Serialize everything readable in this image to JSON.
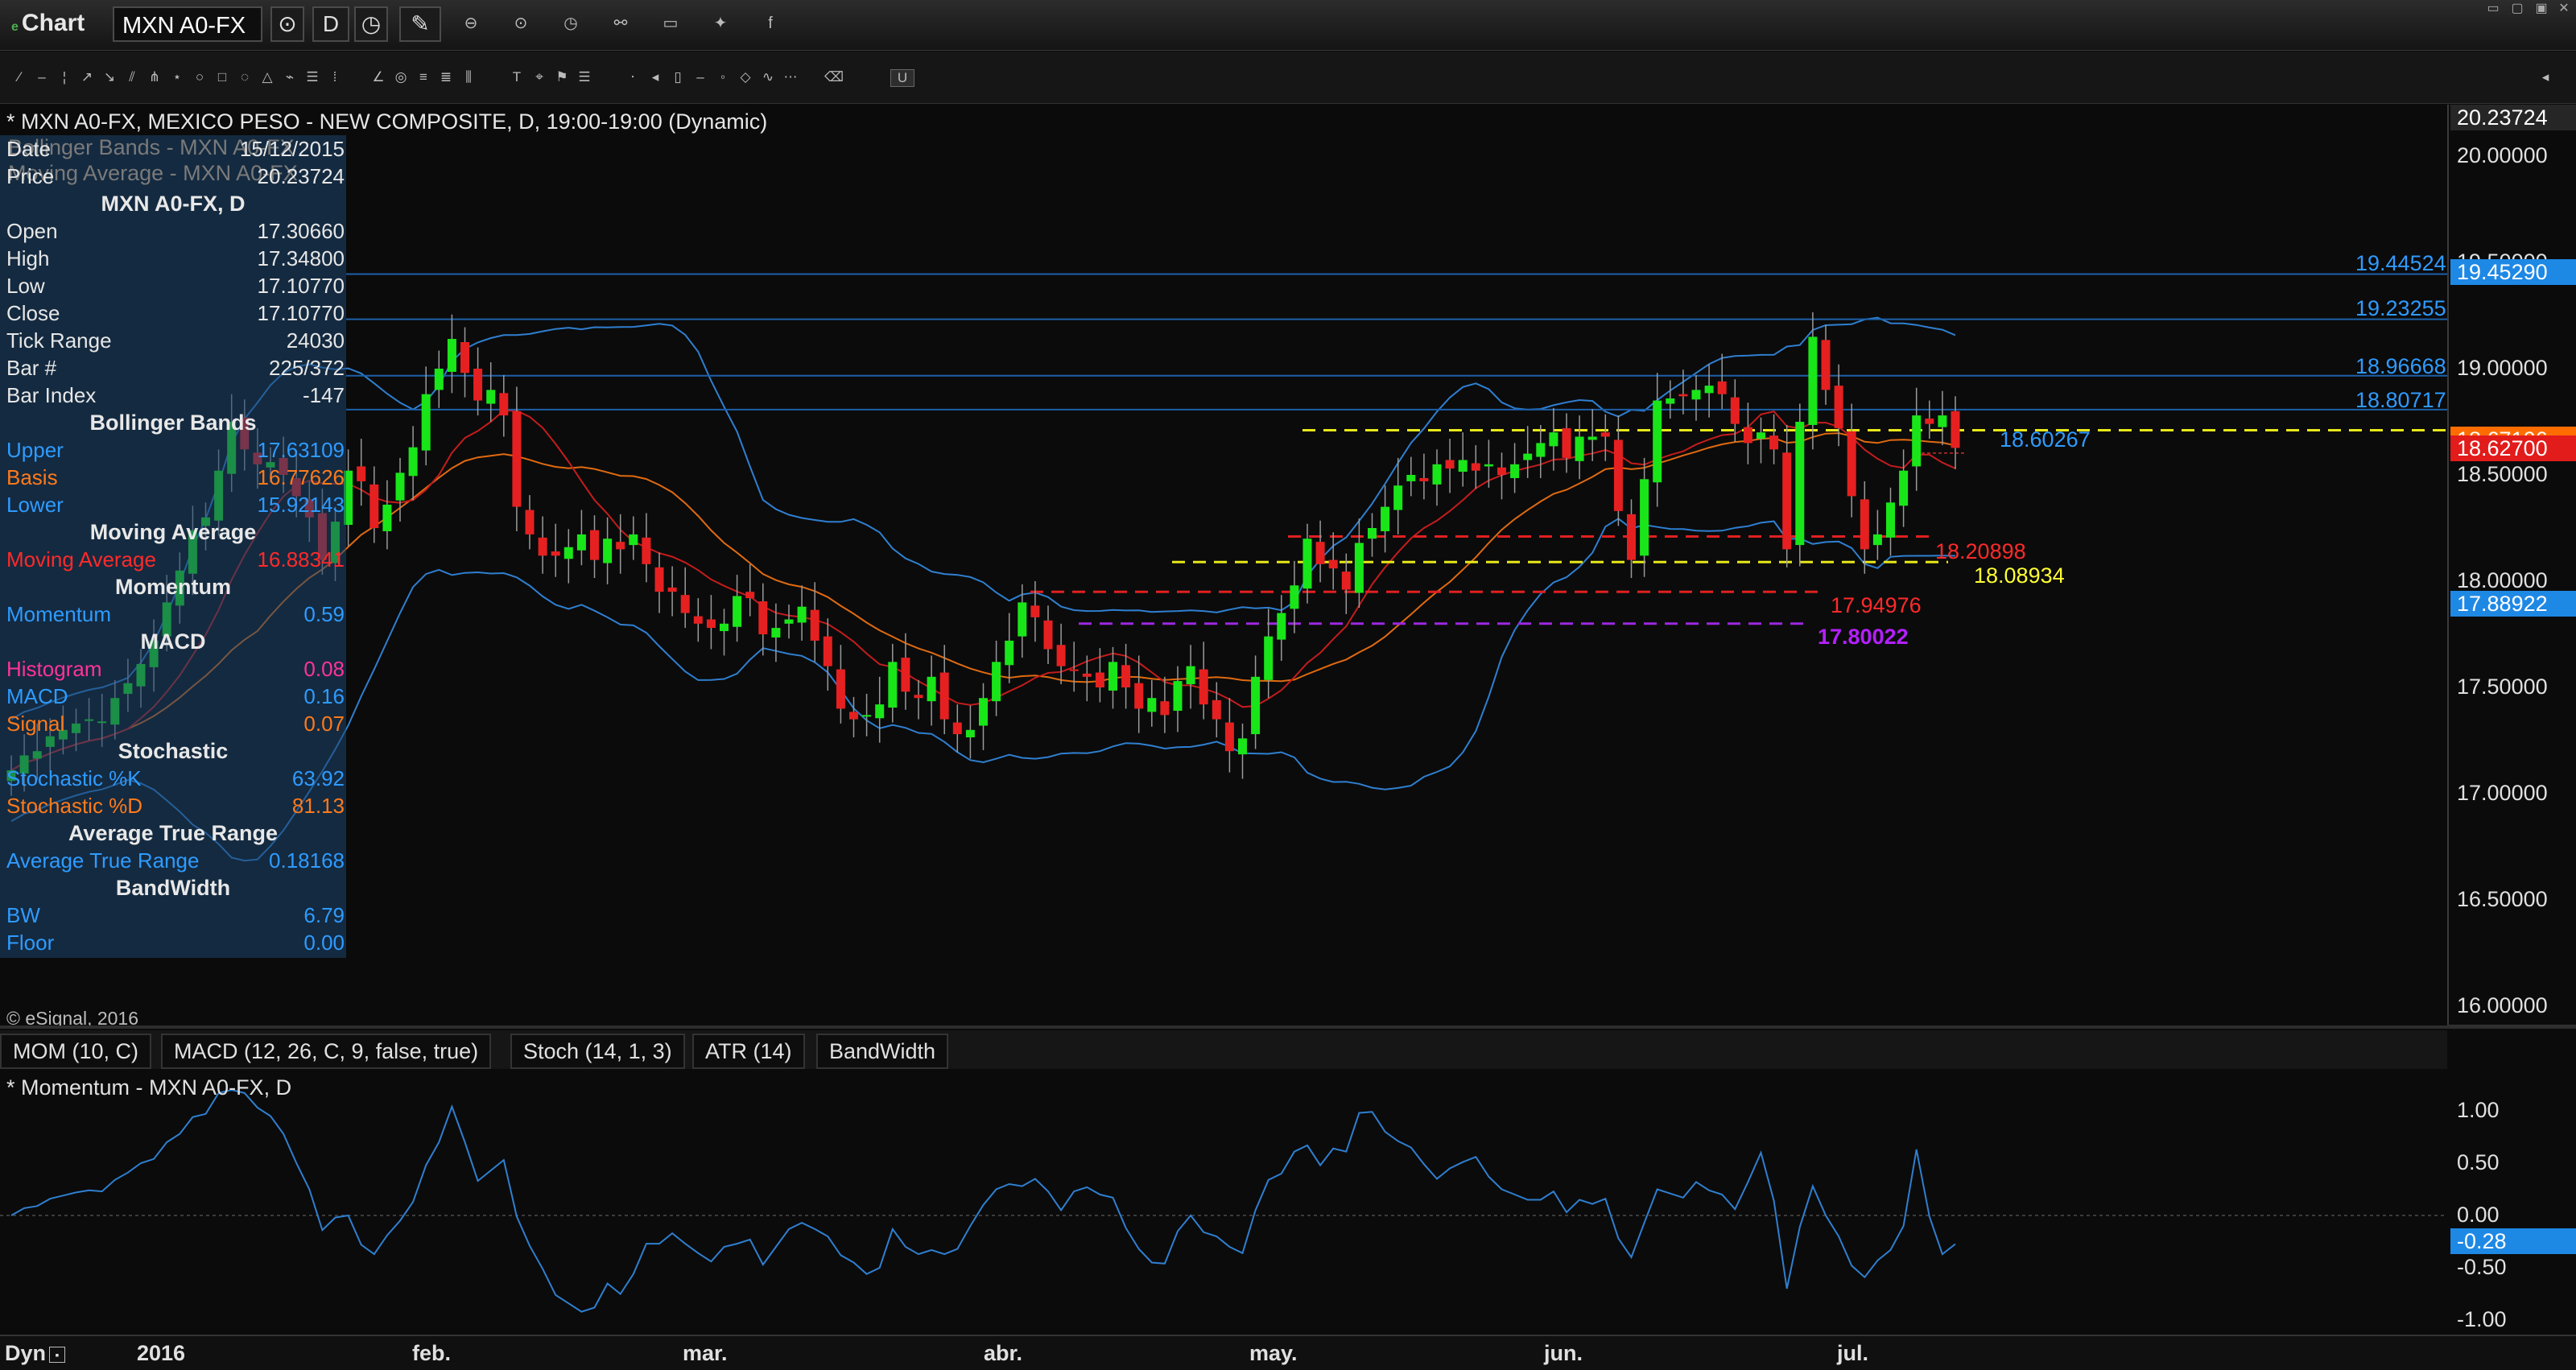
{
  "app": {
    "title": "Chart"
  },
  "toolbar": {
    "symbol": "MXN A0-FX",
    "interval": "D"
  },
  "chart": {
    "title": "* MXN A0-FX, MEXICO PESO - NEW COMPOSITE, D, 19:00-19:00 (Dynamic)",
    "ghost_lines": [
      "Bollinger Bands - MXN A0-FX",
      "Moving Average - MXN A0-FX"
    ],
    "copyright": "© eSignal, 2016"
  },
  "data_window": {
    "top_rows": [
      {
        "k": "Date",
        "v": "15/12/2015"
      },
      {
        "k": "Price",
        "v": "20.23724"
      }
    ],
    "symbol_header": "MXN A0-FX, D",
    "ohlc_rows": [
      {
        "k": "Open",
        "v": "17.30660"
      },
      {
        "k": "High",
        "v": "17.34800"
      },
      {
        "k": "Low",
        "v": "17.10770"
      },
      {
        "k": "Close",
        "v": "17.10770"
      },
      {
        "k": "Tick Range",
        "v": "24030"
      },
      {
        "k": "Bar #",
        "v": "225/372"
      },
      {
        "k": "Bar Index",
        "v": "-147"
      }
    ],
    "sections": [
      {
        "title": "Bollinger Bands",
        "rows": [
          {
            "k": "Upper",
            "v": "17.63109",
            "color": "#2f9bff"
          },
          {
            "k": "Basis",
            "v": "16.77626",
            "color": "#ff7a1a"
          },
          {
            "k": "Lower",
            "v": "15.92143",
            "color": "#2f9bff"
          }
        ]
      },
      {
        "title": "Moving Average",
        "rows": [
          {
            "k": "Moving Average",
            "v": "16.88341",
            "color": "#ff2a2a"
          }
        ]
      },
      {
        "title": "Momentum",
        "rows": [
          {
            "k": "Momentum",
            "v": "0.59",
            "color": "#2f9bff"
          }
        ]
      },
      {
        "title": "MACD",
        "rows": [
          {
            "k": "Histogram",
            "v": "0.08",
            "color": "#ff3399"
          },
          {
            "k": "MACD",
            "v": "0.16",
            "color": "#2f9bff"
          },
          {
            "k": "Signal",
            "v": "0.07",
            "color": "#ff7a1a"
          }
        ]
      },
      {
        "title": "Stochastic",
        "rows": [
          {
            "k": "Stochastic %K",
            "v": "63.92",
            "color": "#2f9bff"
          },
          {
            "k": "Stochastic %D",
            "v": "81.13",
            "color": "#ff7a1a"
          }
        ]
      },
      {
        "title": "Average True Range",
        "rows": [
          {
            "k": "Average True Range",
            "v": "0.18168",
            "color": "#2f9bff"
          }
        ]
      },
      {
        "title": "BandWidth",
        "rows": [
          {
            "k": "BW",
            "v": "6.79",
            "color": "#2f9bff"
          },
          {
            "k": "Floor",
            "v": "0.00",
            "color": "#2f9bff"
          }
        ]
      }
    ]
  },
  "price_axis": {
    "ticks": [
      "20.00000",
      "19.50000",
      "19.00000",
      "18.50000",
      "18.00000",
      "17.50000",
      "17.00000",
      "16.50000",
      "16.00000"
    ],
    "top_tag": "20.23724",
    "upper_tag": "19.45290",
    "covered_tag": "18.67106",
    "last_tag": "18.62700",
    "lower_tag": "17.88922"
  },
  "levels": {
    "blue": [
      "19.44524",
      "19.23255",
      "18.96668",
      "18.80717",
      "18.60267"
    ],
    "red": [
      "18.20898",
      "17.94976"
    ],
    "yellow": "18.08934",
    "purple": "17.80022"
  },
  "indicator_tabs": [
    "MOM (10, C)",
    "MACD (12, 26, C, 9, false, true)",
    "Stoch (14, 1, 3)",
    "ATR (14)",
    "BandWidth"
  ],
  "momentum": {
    "title": "* Momentum - MXN A0-FX, D",
    "ticks": [
      "1.00",
      "0.50",
      "0.00",
      "-0.50",
      "-1.00"
    ],
    "last_tag": "-0.28"
  },
  "time_axis": {
    "prefix": "Dyn",
    "labels": [
      "2016",
      "feb.",
      "mar.",
      "abr.",
      "may.",
      "jun.",
      "jul."
    ]
  },
  "colors": {
    "up": "#19e619",
    "down": "#e62020",
    "band": "#2f7fd0",
    "basis": "#e06a10",
    "ma": "#c41c1c"
  },
  "chart_data": {
    "type": "candlestick",
    "ylim": [
      15.9,
      20.3
    ],
    "series": [
      {
        "name": "MXN A0-FX",
        "closes": [
          17.11,
          17.18,
          17.2,
          17.27,
          17.3,
          17.33,
          17.35,
          17.34,
          17.45,
          17.52,
          17.61,
          17.72,
          17.9,
          18.05,
          18.24,
          18.3,
          18.52,
          18.75,
          18.62,
          18.55,
          18.56,
          18.5,
          18.4,
          18.3,
          18.1,
          18.28,
          18.52,
          18.47,
          18.25,
          18.36,
          18.51,
          18.63,
          18.88,
          19.0,
          19.14,
          18.98,
          18.85,
          18.9,
          18.78,
          18.35,
          18.22,
          18.12,
          18.12,
          18.16,
          18.22,
          18.1,
          18.2,
          18.15,
          18.22,
          18.08,
          17.95,
          17.95,
          17.85,
          17.8,
          17.78,
          17.8,
          17.93,
          17.92,
          17.75,
          17.78,
          17.82,
          17.88,
          17.72,
          17.6,
          17.4,
          17.35,
          17.37,
          17.42,
          17.62,
          17.48,
          17.45,
          17.55,
          17.35,
          17.28,
          17.3,
          17.45,
          17.62,
          17.72,
          17.9,
          17.83,
          17.68,
          17.6,
          17.58,
          17.55,
          17.5,
          17.62,
          17.5,
          17.4,
          17.45,
          17.37,
          17.53,
          17.6,
          17.42,
          17.35,
          17.2,
          17.26,
          17.55,
          17.74,
          17.85,
          17.98,
          18.2,
          18.08,
          18.06,
          17.96,
          18.18,
          18.25,
          18.35,
          18.45,
          18.5,
          18.47,
          18.55,
          18.53,
          18.57,
          18.52,
          18.55,
          18.5,
          18.55,
          18.6,
          18.65,
          18.7,
          18.58,
          18.68,
          18.68,
          18.68,
          18.33,
          18.1,
          18.48,
          18.85,
          18.86,
          18.87,
          18.9,
          18.92,
          18.88,
          18.74,
          18.65,
          18.7,
          18.62,
          18.15,
          18.75,
          19.15,
          18.9,
          18.72,
          18.4,
          18.15,
          18.22,
          18.37,
          18.52,
          18.78,
          18.74,
          18.78,
          18.627
        ]
      }
    ]
  }
}
